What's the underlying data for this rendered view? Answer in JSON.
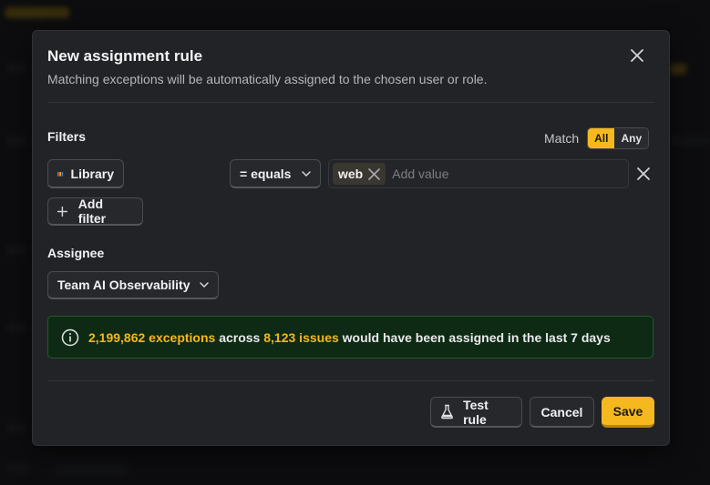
{
  "modal": {
    "title": "New assignment rule",
    "subtitle": "Matching exceptions will be automatically assigned to the chosen user or role."
  },
  "filters": {
    "label": "Filters",
    "match_label": "Match",
    "match_options": [
      "All",
      "Any"
    ],
    "match_selected": "All",
    "property": "Library",
    "operator": "= equals",
    "values": [
      "web"
    ],
    "value_placeholder": "Add value",
    "add_filter_label": "Add filter"
  },
  "assignee": {
    "label": "Assignee",
    "selected": "Team AI Observability"
  },
  "summary": {
    "exceptions": "2,199,862 exceptions",
    "across": "across",
    "issues": "8,123 issues",
    "rest": "would have been assigned in the last 7 days"
  },
  "footer": {
    "test_label": "Test rule",
    "cancel_label": "Cancel",
    "save_label": "Save"
  },
  "colors": {
    "accent": "#f5b81f",
    "success_bg": "#0e2a14"
  }
}
